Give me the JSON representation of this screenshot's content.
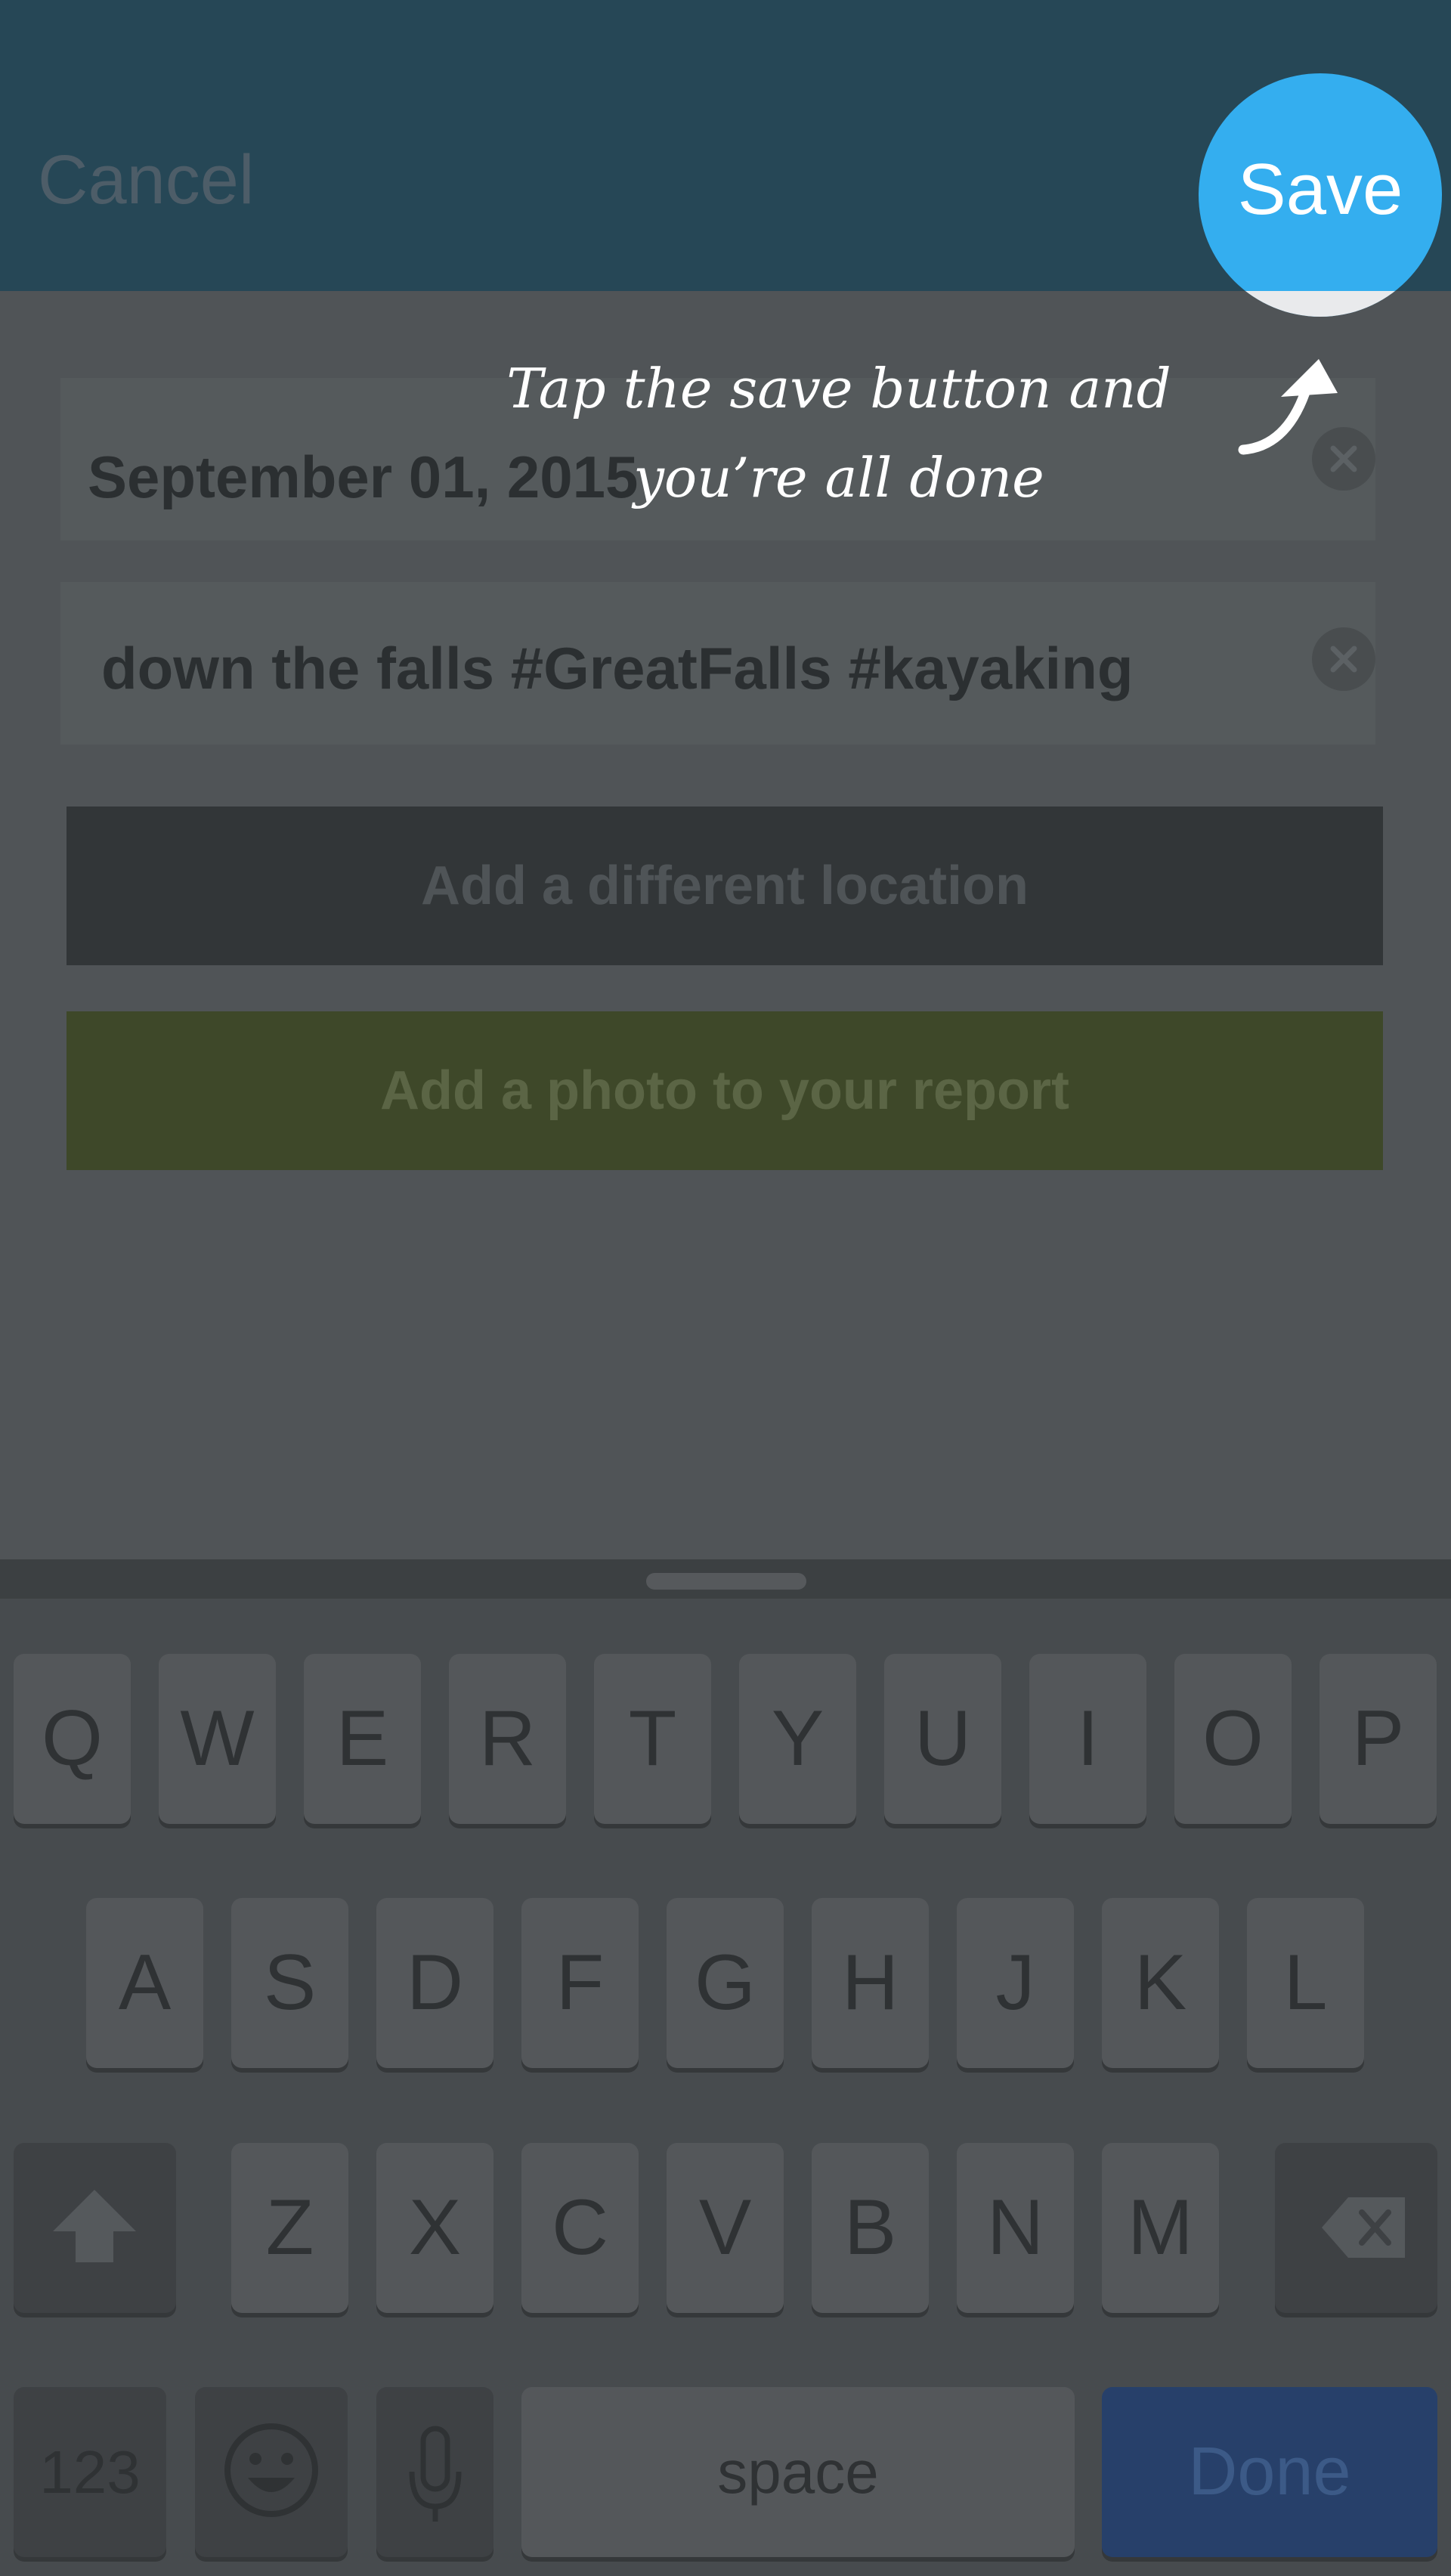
{
  "header": {
    "cancel_label": "Cancel",
    "save_label": "Save"
  },
  "coachmark": {
    "line1": "Tap the save button and",
    "line2": "you’re all done"
  },
  "form": {
    "date_value": "September 01, 2015",
    "description_value": "down the falls #GreatFalls #kayaking",
    "location_button": "Add a different location",
    "photo_button": "Add a photo to your report"
  },
  "keyboard": {
    "row1": [
      "Q",
      "W",
      "E",
      "R",
      "T",
      "Y",
      "U",
      "I",
      "O",
      "P"
    ],
    "row2": [
      "A",
      "S",
      "D",
      "F",
      "G",
      "H",
      "J",
      "K",
      "L"
    ],
    "row3": [
      "Z",
      "X",
      "C",
      "V",
      "B",
      "N",
      "M"
    ],
    "numbers_label": "123",
    "space_label": "space",
    "done_label": "Done"
  },
  "colors": {
    "header": "#264756",
    "save_accent": "#34aeef",
    "photo_button": "#3e4829",
    "done_key": "#27406a"
  },
  "icons": [
    "clear-icon",
    "arrow-icon",
    "shift-icon",
    "delete-icon",
    "emoji-icon",
    "mic-icon"
  ]
}
